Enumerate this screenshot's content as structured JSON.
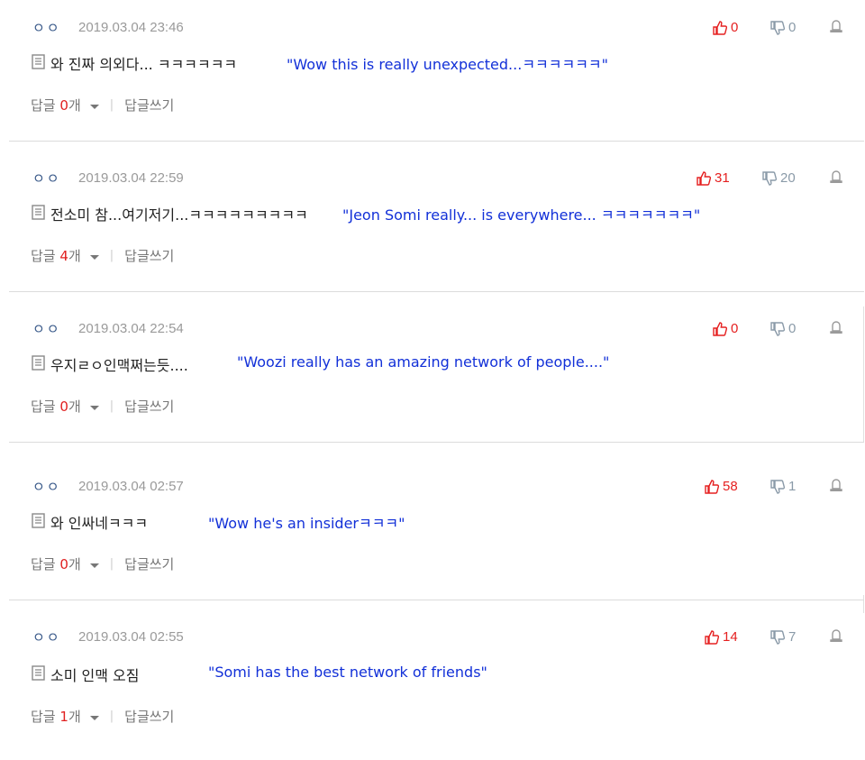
{
  "comments": [
    {
      "user": "ㅇㅇ",
      "date": "2019.03.04 23:46",
      "likes": "0",
      "dislikes": "0",
      "text": "와 진짜 의외다... ㅋㅋㅋㅋㅋㅋ",
      "translation": "\"Wow this is really unexpected...ㅋㅋㅋㅋㅋㅋ\"",
      "reply_label": "답글",
      "reply_count": "0",
      "reply_suffix": "개",
      "write_label": "답글쓰기"
    },
    {
      "user": "ㅇㅇ",
      "date": "2019.03.04 22:59",
      "likes": "31",
      "dislikes": "20",
      "text": "전소미 참...여기저기...ㅋㅋㅋㅋㅋㅋㅋㅋㅋ",
      "translation": "\"Jeon Somi really... is everywhere... ㅋㅋㅋㅋㅋㅋㅋ\"",
      "reply_label": "답글",
      "reply_count": "4",
      "reply_suffix": "개",
      "write_label": "답글쓰기"
    },
    {
      "user": "ㅇㅇ",
      "date": "2019.03.04 22:54",
      "likes": "0",
      "dislikes": "0",
      "text": "우지ㄹㅇ인맥쩌는듯....",
      "translation": "\"Woozi really has an amazing network of people....\"",
      "reply_label": "답글",
      "reply_count": "0",
      "reply_suffix": "개",
      "write_label": "답글쓰기"
    },
    {
      "user": "ㅇㅇ",
      "date": "2019.03.04 02:57",
      "likes": "58",
      "dislikes": "1",
      "text": "와 인싸네ㅋㅋㅋ",
      "translation": "\"Wow he's an insiderㅋㅋㅋ\"",
      "reply_label": "답글",
      "reply_count": "0",
      "reply_suffix": "개",
      "write_label": "답글쓰기"
    },
    {
      "user": "ㅇㅇ",
      "date": "2019.03.04 02:55",
      "likes": "14",
      "dislikes": "7",
      "text": "소미 인맥 오짐",
      "translation": "\"Somi has the best network of friends\"",
      "reply_label": "답글",
      "reply_count": "1",
      "reply_suffix": "개",
      "write_label": "답글쓰기"
    }
  ],
  "colors": {
    "like": "#e52020",
    "dislike": "#8a9aa8",
    "translation": "#1230d8",
    "reply_count": "#e02020"
  }
}
